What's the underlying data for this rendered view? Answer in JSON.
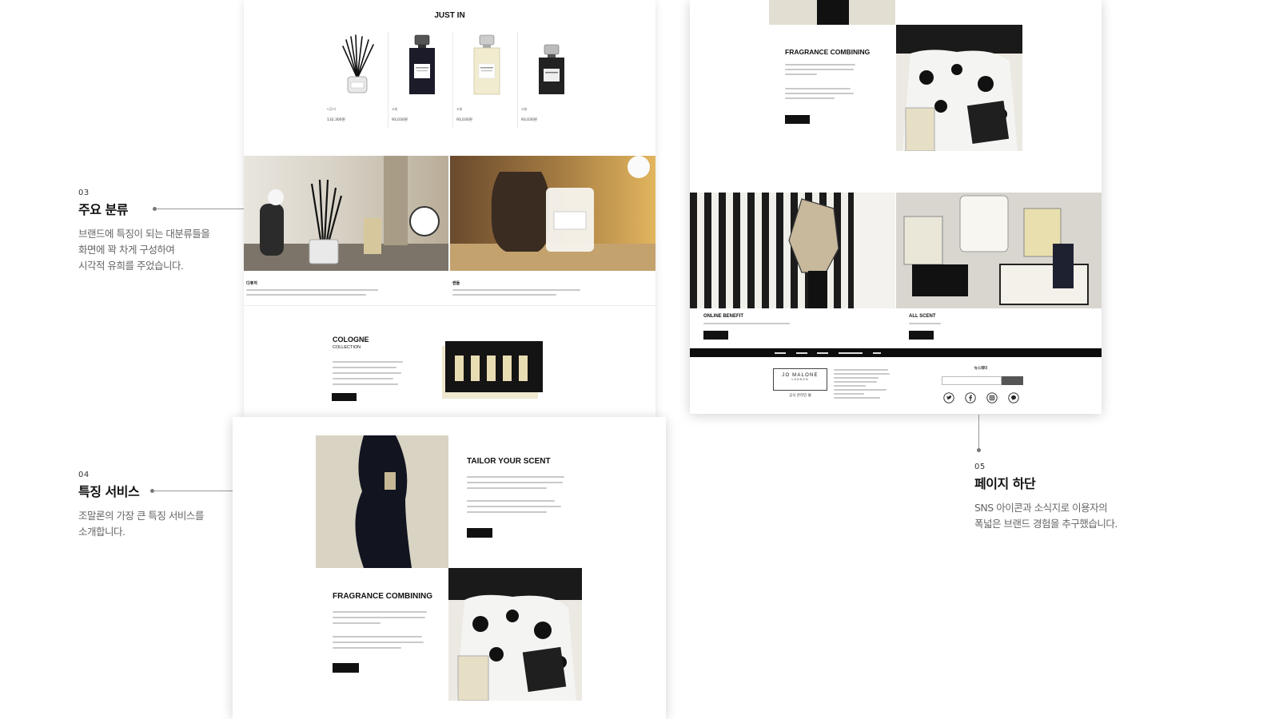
{
  "annotations": {
    "a03": {
      "number": "03",
      "title": "주요 분류",
      "lines": [
        "브랜드에 특징이 되는 대분류들을",
        "화면에 꽉 차게 구성하여",
        "시각적 유희를 주었습니다."
      ]
    },
    "a04": {
      "number": "04",
      "title": "특징 서비스",
      "lines": [
        "조말론의 가장 큰 특징 서비스를",
        "소개합니다."
      ]
    },
    "a05": {
      "number": "05",
      "title": "페이지 하단",
      "lines": [
        "SNS 아이콘과 소식지로 이용자의",
        "폭넓은 브랜드 경험을 추구했습니다."
      ]
    }
  },
  "panel_a": {
    "just_in_title": "JUST IN",
    "products": [
      {
        "name": "디퓨저",
        "price": "132,300원",
        "icon": "diffuser-icon"
      },
      {
        "name": "코롱",
        "price": "93,030원",
        "icon": "cologne-dark-bottle-icon"
      },
      {
        "name": "코롱",
        "price": "93,030원",
        "icon": "cologne-clear-bottle-icon"
      },
      {
        "name": "코롱",
        "price": "93,030원",
        "icon": "cologne-black-bottle-icon"
      }
    ],
    "categories": [
      {
        "label": "디퓨저",
        "image": "diffuser-photo"
      },
      {
        "label": "캔들",
        "image": "candle-photo"
      }
    ],
    "cologne_title": "COLOGNE",
    "cologne_subtitle": "COLLECTION",
    "cologne_image": "cologne-collection-box-photo"
  },
  "panel_b": {
    "tailor_title": "TAILOR YOUR SCENT",
    "fragrance_title": "FRAGRANCE COMBINING"
  },
  "panel_c": {
    "fragrance_title": "FRAGRANCE COMBINING",
    "online_benefit": "ONLINE BENEFIT",
    "all_scent": "ALL SCENT",
    "logo_text": "JO MALONE",
    "logo_subtext": "LONDON",
    "logo_caption": "공식 온라인 몰",
    "newsletter_title": "뉴스레터",
    "sns_icons": [
      "twitter-icon",
      "facebook-icon",
      "instagram-icon",
      "kakao-icon"
    ]
  },
  "colors": {
    "accent": "#111111",
    "annotation_text": "#666666",
    "connector": "#999999"
  }
}
